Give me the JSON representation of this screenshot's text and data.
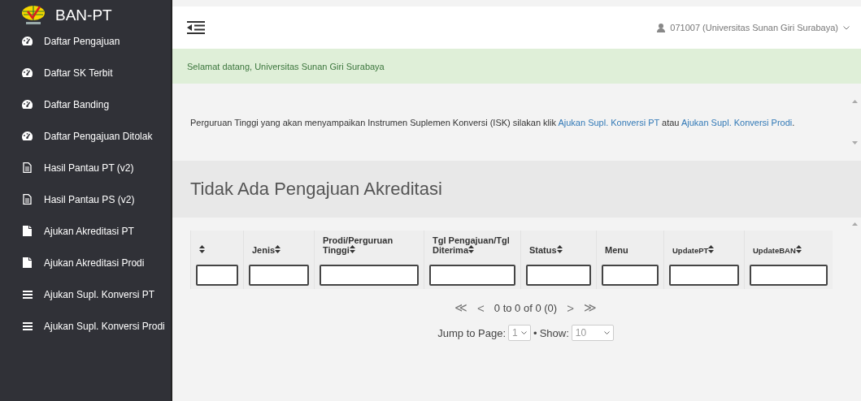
{
  "sidebar": {
    "brand": "BAN-PT",
    "items": [
      {
        "label": "Daftar Pengajuan",
        "kind": "dashboard"
      },
      {
        "label": "Daftar SK Terbit",
        "kind": "dashboard"
      },
      {
        "label": "Daftar Banding",
        "kind": "dashboard"
      },
      {
        "label": "Daftar Pengajuan Ditolak",
        "kind": "dashboard"
      },
      {
        "label": "Hasil Pantau PT (v2)",
        "kind": "report"
      },
      {
        "label": "Hasil Pantau PS (v2)",
        "kind": "report"
      },
      {
        "label": "Ajukan Akreditasi PT",
        "kind": "form"
      },
      {
        "label": "Ajukan Akreditasi Prodi",
        "kind": "form"
      },
      {
        "label": "Ajukan Supl. Konversi PT",
        "kind": "list"
      },
      {
        "label": "Ajukan Supl. Konversi Prodi",
        "kind": "list"
      }
    ]
  },
  "topbar": {
    "user": "071007 (Universitas Sunan Giri Surabaya)"
  },
  "alert": "Selamat datang, Universitas Sunan Giri Surabaya",
  "notice": {
    "text": "Perguruan Tinggi yang akan menyampaikan Instrumen Suplemen Konversi (ISK) silakan klik",
    "link_1": "Ajukan Supl. Konversi PT",
    "middle": "atau",
    "link_2": "Ajukan Supl. Konversi Prodi",
    "end": "."
  },
  "heading": "Tidak Ada Pengajuan Akreditasi",
  "table": {
    "columns": [
      {
        "sortable": true
      },
      {
        "label": "Jenis",
        "sortable": true
      },
      {
        "label": "Prodi/Perguruan Tinggi",
        "sortable": true
      },
      {
        "label": "Tgl Pengajuan/Tgl Diterima",
        "sortable": true
      },
      {
        "label": "Status",
        "sortable": true
      },
      {
        "label": "Menu",
        "sortable": false
      },
      {
        "label": "UpdatePT",
        "sortable": true
      },
      {
        "label": "UpdateBAN",
        "sortable": true
      }
    ]
  },
  "pagination": {
    "first": "≪",
    "prev": "<",
    "range": "0 to 0 of 0 (0)",
    "next": ">",
    "last": "≫",
    "jump_label": "Jump to Page:",
    "page": "1",
    "separator": "•",
    "show_label": "Show:",
    "show": "10"
  }
}
